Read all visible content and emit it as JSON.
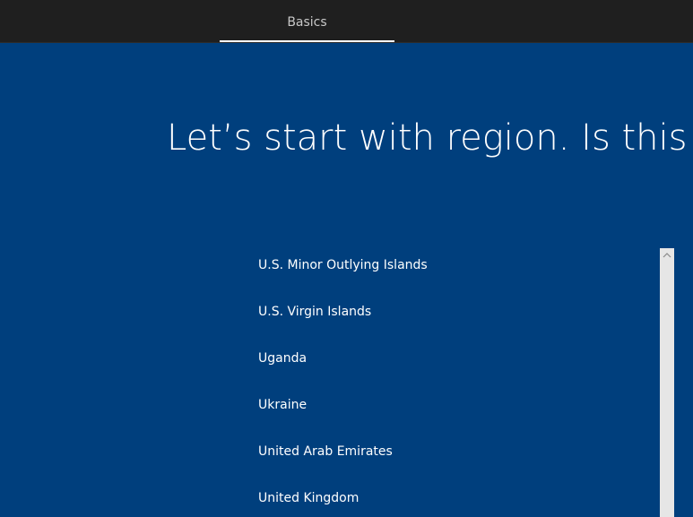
{
  "topbar": {
    "tabs": [
      {
        "label": "Basics",
        "active": true
      }
    ]
  },
  "main": {
    "heading": "Let’s start with region. Is this rig",
    "regions": [
      "U.S. Minor Outlying Islands",
      "U.S. Virgin Islands",
      "Uganda",
      "Ukraine",
      "United Arab Emirates",
      "United Kingdom"
    ]
  },
  "icons": {
    "scroll_up": "chevron-up-icon"
  },
  "colors": {
    "background": "#003f7d",
    "topbar": "#1f1f1f",
    "tab_text": "#c8c8c8",
    "text": "#ffffff",
    "scrollbar_track": "#e6e6e6"
  }
}
